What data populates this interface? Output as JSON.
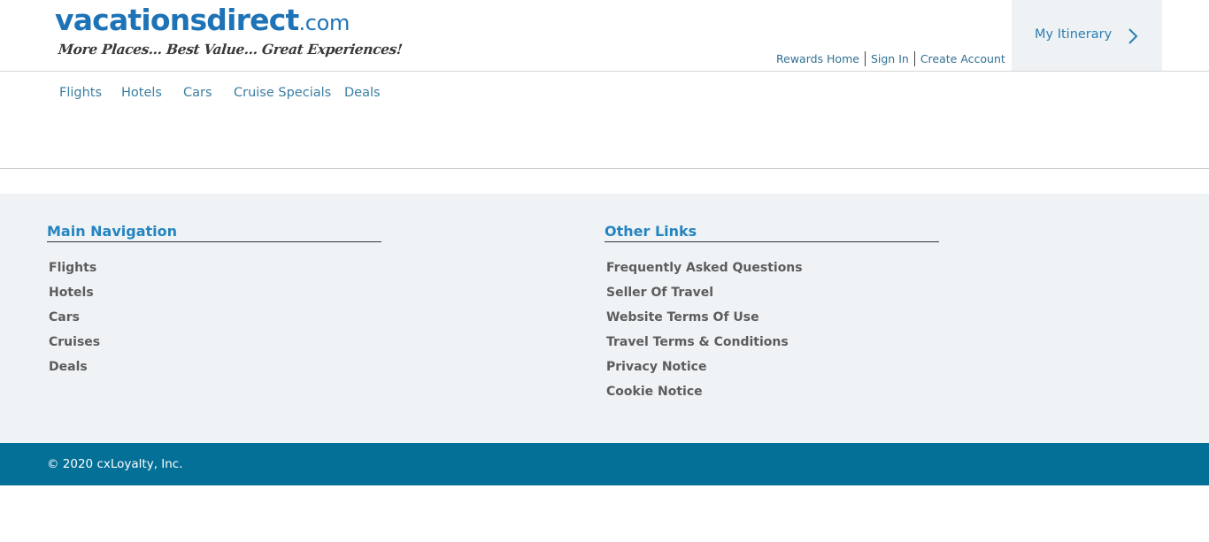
{
  "header": {
    "logo": {
      "brand_name": "vacationsdirect",
      "brand_suffix": ".com",
      "tagline": "More Places... Best Value... Great Experiences!"
    },
    "utility_links": [
      {
        "label": "Rewards Home"
      },
      {
        "label": "Sign In"
      },
      {
        "label": "Create Account"
      }
    ],
    "itinerary": {
      "label": "My Itinerary",
      "icon": "chevron-right-icon"
    }
  },
  "nav": {
    "items": [
      {
        "label": "Flights"
      },
      {
        "label": "Hotels"
      },
      {
        "label": "Cars"
      },
      {
        "label": "Cruise Specials"
      },
      {
        "label": "Deals"
      }
    ]
  },
  "footer": {
    "main_navigation": {
      "title": "Main Navigation",
      "links": [
        "Flights",
        "Hotels",
        "Cars",
        "Cruises",
        "Deals"
      ]
    },
    "other_links": {
      "title": "Other Links",
      "links": [
        "Frequently Asked Questions",
        "Seller Of Travel",
        "Website Terms Of Use",
        "Travel Terms & Conditions",
        "Privacy Notice",
        "Cookie Notice"
      ]
    },
    "copyright": "© 2020 cxLoyalty, Inc."
  },
  "colors": {
    "brand_blue": "#1e73b6",
    "link_blue": "#2f6f93",
    "footer_bg": "#eff3f6",
    "copyright_bar": "#046f97"
  }
}
